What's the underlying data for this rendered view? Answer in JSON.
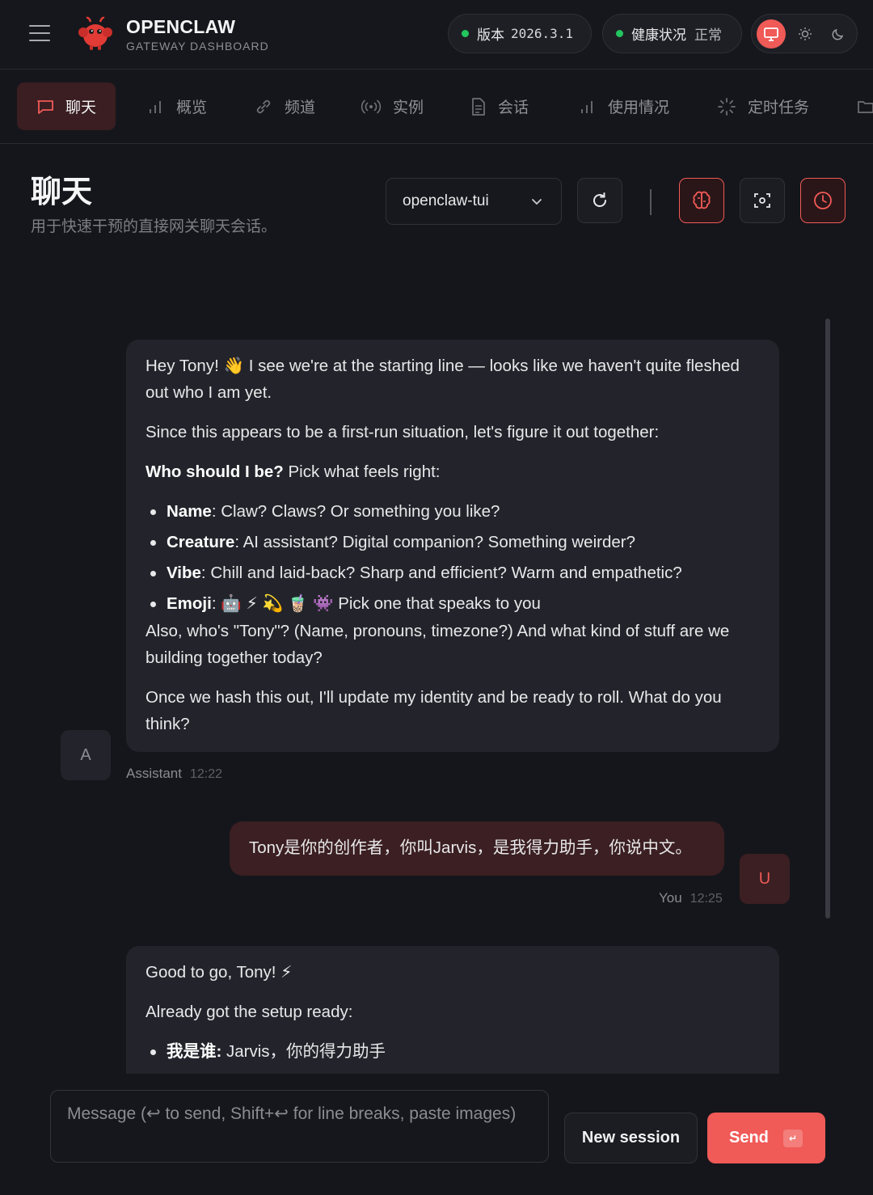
{
  "header": {
    "brand_title": "OPENCLAW",
    "brand_sub": "GATEWAY DASHBOARD",
    "version_label": "版本",
    "version_value": "2026.3.1",
    "health_label": "健康状况",
    "health_value": "正常",
    "status_color": "#22c55e",
    "accent_color": "#f05a57"
  },
  "nav": {
    "items": [
      {
        "label": "聊天",
        "icon": "chat-bubble-icon"
      },
      {
        "label": "概览",
        "icon": "bar-chart-icon"
      },
      {
        "label": "频道",
        "icon": "link-icon"
      },
      {
        "label": "实例",
        "icon": "broadcast-icon"
      },
      {
        "label": "会话",
        "icon": "document-icon"
      },
      {
        "label": "使用情况",
        "icon": "bar-chart-icon"
      },
      {
        "label": "定时任务",
        "icon": "loader-icon"
      }
    ]
  },
  "page": {
    "title": "聊天",
    "subtitle": "用于快速干预的直接网关聊天会话。",
    "session_select": "openclaw-tui"
  },
  "messages": {
    "m1": {
      "p1": "Hey Tony! 👋 I see we're at the starting line — looks like we haven't quite fleshed out who I am yet.",
      "p2": "Since this appears to be a first-run situation, let's figure it out together:",
      "who_bold": "Who should I be?",
      "who_rest": " Pick what feels right:",
      "b1_bold": "Name",
      "b1_rest": ": Claw? Claws? Or something you like?",
      "b2_bold": "Creature",
      "b2_rest": ": AI assistant? Digital companion? Something weirder?",
      "b3_bold": "Vibe",
      "b3_rest": ": Chill and laid-back? Sharp and efficient? Warm and empathetic?",
      "b4_bold": "Emoji",
      "b4_emojis": ":  🤖  ⚡  💫  🧋  👾 ",
      "b4_rest": "Pick one that speaks to you",
      "p3": "Also, who's \"Tony\"? (Name, pronouns, timezone?) And what kind of stuff are we building together today?",
      "p4": "Once we hash this out, I'll update my identity and be ready to roll. What do you think?",
      "avatar": "A",
      "sender": "Assistant",
      "time": "12:22"
    },
    "m2": {
      "text": "Tony是你的创作者，你叫Jarvis，是我得力助手，你说中文。",
      "avatar": "U",
      "sender": "You",
      "time": "12:25"
    },
    "m3": {
      "p1": "Good to go, Tony! ⚡",
      "p2": "Already got the setup ready:",
      "b1_bold": "我是谁:",
      "b1_rest": " Jarvis，你的得力助手"
    }
  },
  "composer": {
    "placeholder": "Message (↩ to send, Shift+↩ for line breaks, paste images)",
    "new_session": "New session",
    "send": "Send",
    "send_kbd": "↵"
  }
}
